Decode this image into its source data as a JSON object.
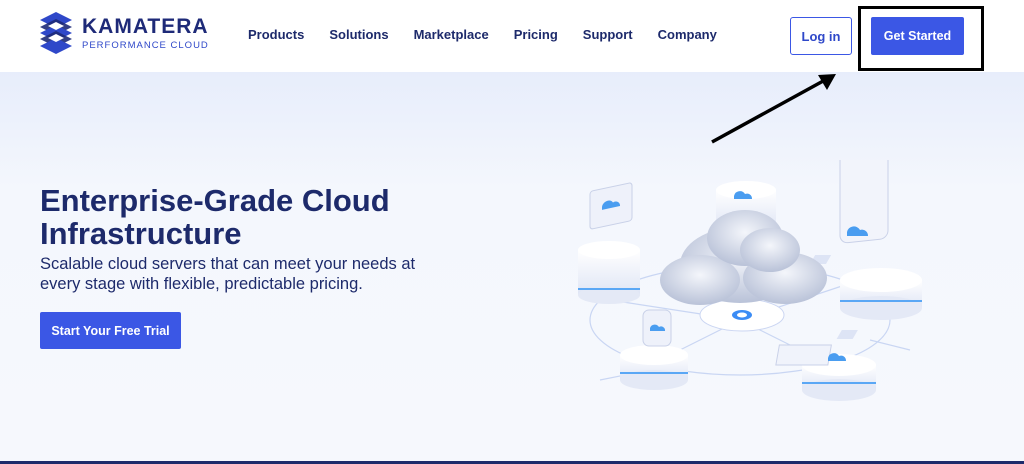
{
  "brand": {
    "name": "KAMATERA",
    "tagline": "PERFORMANCE CLOUD",
    "color_primary": "#3b57e5",
    "color_dark": "#1d2a6b"
  },
  "nav": {
    "items": [
      "Products",
      "Solutions",
      "Marketplace",
      "Pricing",
      "Support",
      "Company"
    ]
  },
  "header": {
    "login_label": "Log in",
    "get_started_label": "Get Started"
  },
  "hero": {
    "title": "Enterprise-Grade Cloud Infrastructure",
    "subtitle": "Scalable cloud servers that can meet your needs at every stage with flexible, predictable pricing.",
    "cta_label": "Start Your Free Trial"
  },
  "annotation": {
    "highlight_color": "#000000",
    "target": "get-started-button"
  },
  "illustration": {
    "icon": "cloud-servers-illustration"
  }
}
